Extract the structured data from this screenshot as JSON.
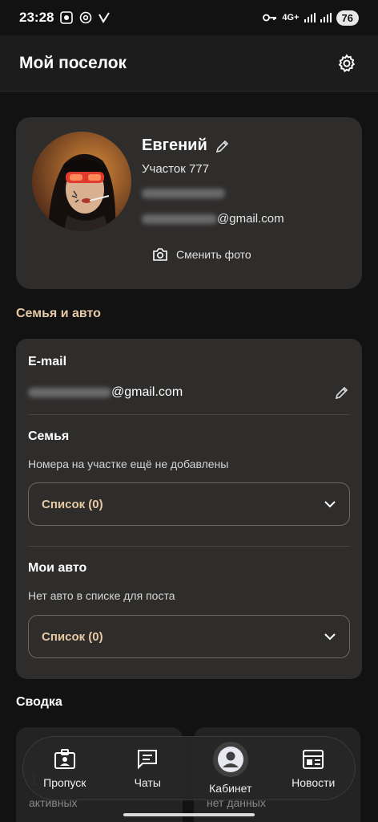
{
  "status": {
    "time": "23:28",
    "network": "4G+",
    "battery": "76"
  },
  "header": {
    "title": "Мой поселок"
  },
  "profile": {
    "name": "Евгений",
    "plot": "Участок 777",
    "email_suffix": "@gmail.com",
    "change_photo": "Сменить фото"
  },
  "family_section": {
    "title": "Семья и авто",
    "email_label": "E-mail",
    "email_suffix": "@gmail.com",
    "family_label": "Семья",
    "family_hint": "Номера на участке ещё не добавлены",
    "family_dropdown": "Список (0)",
    "cars_label": "Мои авто",
    "cars_hint": "Нет авто в списке для поста",
    "cars_dropdown": "Список (0)"
  },
  "summary": {
    "title": "Сводка",
    "cards": [
      {
        "value": "1",
        "sub": "активных"
      },
      {
        "value": "",
        "sub": "нет данных"
      }
    ]
  },
  "nav": {
    "items": [
      {
        "label": "Пропуск",
        "icon": "badge-icon"
      },
      {
        "label": "Чаты",
        "icon": "chat-icon"
      },
      {
        "label": "Кабинет",
        "icon": "account-icon"
      },
      {
        "label": "Новости",
        "icon": "news-icon"
      }
    ],
    "active": "Кабинет"
  },
  "colors": {
    "accent": "#e7c9a4",
    "card": "#2e2d2c",
    "background": "#121212"
  }
}
